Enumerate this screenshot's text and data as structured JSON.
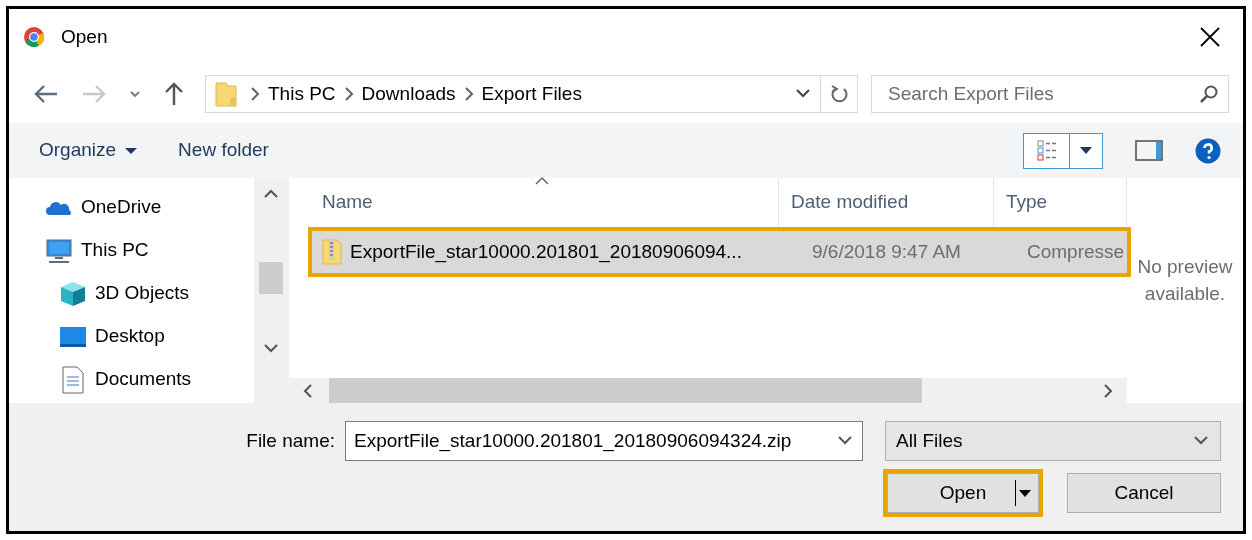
{
  "window": {
    "title": "Open"
  },
  "nav_buttons": [
    {
      "kind": "back",
      "disabled": false
    },
    {
      "kind": "forward",
      "disabled": true
    },
    {
      "kind": "recent",
      "disabled": false
    },
    {
      "kind": "up",
      "disabled": false
    }
  ],
  "address": {
    "path": [
      "This PC",
      "Downloads",
      "Export Files"
    ]
  },
  "search": {
    "placeholder": "Search Export Files"
  },
  "toolbar": {
    "organize": "Organize",
    "new_folder": "New folder"
  },
  "sidebar": {
    "items": [
      {
        "label": "OneDrive",
        "kind": "cloud"
      },
      {
        "label": "This PC",
        "kind": "computer",
        "children": [
          {
            "label": "3D Objects",
            "kind": "cube"
          },
          {
            "label": "Desktop",
            "kind": "desktop"
          },
          {
            "label": "Documents",
            "kind": "document"
          }
        ]
      }
    ]
  },
  "table": {
    "columns": [
      {
        "label": "Name",
        "sorted": true
      },
      {
        "label": "Date modified",
        "sorted": false
      },
      {
        "label": "Type",
        "sorted": false
      }
    ],
    "rows": [
      {
        "cells": [
          "ExportFile_star10000.201801_20180906094...",
          "9/6/2018 9:47 AM",
          "Compresse"
        ],
        "selected": true,
        "highlighted": true
      }
    ]
  },
  "preview": {
    "text": "No preview available."
  },
  "file_name": {
    "label": "File name:",
    "value": "ExportFile_star10000.201801_20180906094324.zip"
  },
  "file_type": {
    "value": "All Files"
  },
  "buttons": [
    {
      "label": "Open",
      "kind": "split",
      "highlighted": true
    },
    {
      "label": "Cancel",
      "kind": "plain",
      "highlighted": false
    }
  ]
}
